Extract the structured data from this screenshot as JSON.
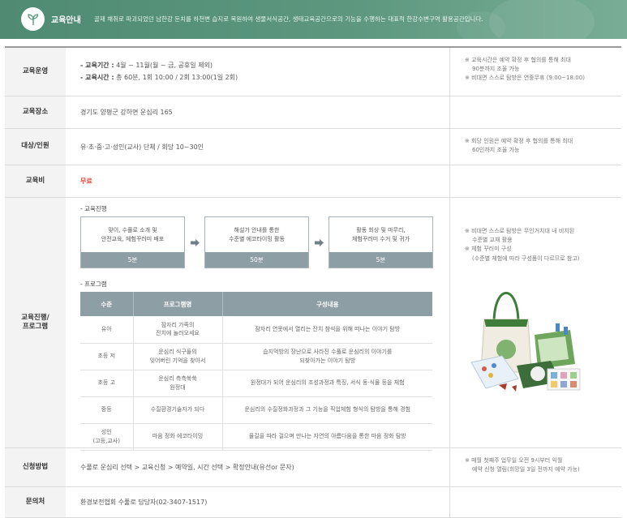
{
  "banner": {
    "title": "교육안내",
    "description": "골재 채취로 파괴되었던 남한강 둔치를 하천변 습지로 복원하여 생물서식공간, 생태교육공간으로의 기능을 수행하는 대표적 한강수변구역 활용공간입니다.",
    "icon": "leaf-sprout-icon"
  },
  "rows": {
    "operation": {
      "label": "교육운영",
      "period_label": "- 교육기간 :",
      "period_value": "4월 ~ 11월(월 ~ 금, 공휴일 제외)",
      "time_label": "- 교육시간 :",
      "time_value": "총 60분, 1회 10:00 / 2회 13:00(1일 2회)",
      "note1": "※ 교육시간은 예약 확정 후 협의를 통해 최대",
      "note1b": "90분까지 조율 가능",
      "note2": "※ 비대면 스스로 탐방은 연중무휴 (9:00~18:00)"
    },
    "place": {
      "label": "교육장소",
      "value": "경기도 양평군 강하면 운심리 165"
    },
    "target": {
      "label": "대상/인원",
      "value": "유·초·중·고·성인(교사) 단체 / 회당 10~30인",
      "note1": "※ 회당 인원은 예약 확정 후 협의를 통해 최대",
      "note1b": "60인까지 조율 가능"
    },
    "fee": {
      "label": "교육비",
      "value": "무료"
    },
    "program": {
      "label_line1": "교육진행/",
      "label_line2": "프로그램",
      "steps_heading": "- 교육진행",
      "steps": [
        {
          "line1": "맞이, 수풀로 소개 및",
          "line2": "안전교육, 체험꾸러미 배포",
          "time": "5분"
        },
        {
          "line1": "해설가 안내를 통한",
          "line2": "수준별 에코타이밍 활동",
          "time": "50분"
        },
        {
          "line1": "활동 회상 및 마무리,",
          "line2": "체험꾸러미 수거 및 귀가",
          "time": "5분"
        }
      ],
      "program_heading": "- 프로그램",
      "columns": [
        "수준",
        "프로그램명",
        "구성내용"
      ],
      "table": [
        {
          "level": [
            "유아"
          ],
          "name": [
            "잠자리 가족의",
            "잔치에 놀러오세요"
          ],
          "content": [
            "잠자리 연못에서 열리는 잔치 참석을 위해 떠나는 이야기 탐방"
          ]
        },
        {
          "level": [
            "초등 저"
          ],
          "name": [
            "운심리 식구들의",
            "잊어버린 기억을 찾아서"
          ],
          "content": [
            "습지먹방의 장난으로 사라진 수풀로 운심리의 이야기를",
            "되찾아가는 이야기 탐방"
          ]
        },
        {
          "level": [
            "초등 고"
          ],
          "name": [
            "운심리 측측쑥쑥",
            "원정대"
          ],
          "content": [
            "원정대가 되어 운심리의 조성과정과 특징, 서식 동·식물 등을 체험"
          ]
        },
        {
          "level": [
            "중등"
          ],
          "name": [
            "수질환경기술자가 되다"
          ],
          "content": [
            "운심리의 수질정화과정과 그 기능을 직업체험 형식의 탐방을 통해 경험"
          ]
        },
        {
          "level": [
            "성인",
            "(고등,교사)"
          ],
          "name": [
            "마음 정화 에코타이밍"
          ],
          "content": [
            "물길을 따라 걸으며 만나는 자연의 아름다움을 통한 마음 정화 탐방"
          ]
        }
      ],
      "note1": "※ 비대면 스스로 탐방은 무인거치대 내 비치된",
      "note1b": "수준별 교재 활용",
      "note2": "※ 체험 꾸러미 구성",
      "note2b": "(수준별 체험에 따라 구성품이 다르므로 참고)"
    },
    "apply": {
      "label": "신청방법",
      "value": "수풀로 운심리 선택 > 교육신청 > 예약일, 시간 선택 > 확정안내(유선or 문자)",
      "note1": "※ 매월 첫째주 업무일 오전 9시부터 익월",
      "note1b": "예약 신청 열림(희망일 3일 전까지 예약 가능)"
    },
    "contact": {
      "label": "문의처",
      "value": "환경보전협회 수풀로 담당자(02-3407-1517)"
    }
  },
  "colors": {
    "banner": "#5c977e",
    "table_header": "#8e9ea5",
    "fee": "#e2483b",
    "arrow": "#6f8089"
  }
}
